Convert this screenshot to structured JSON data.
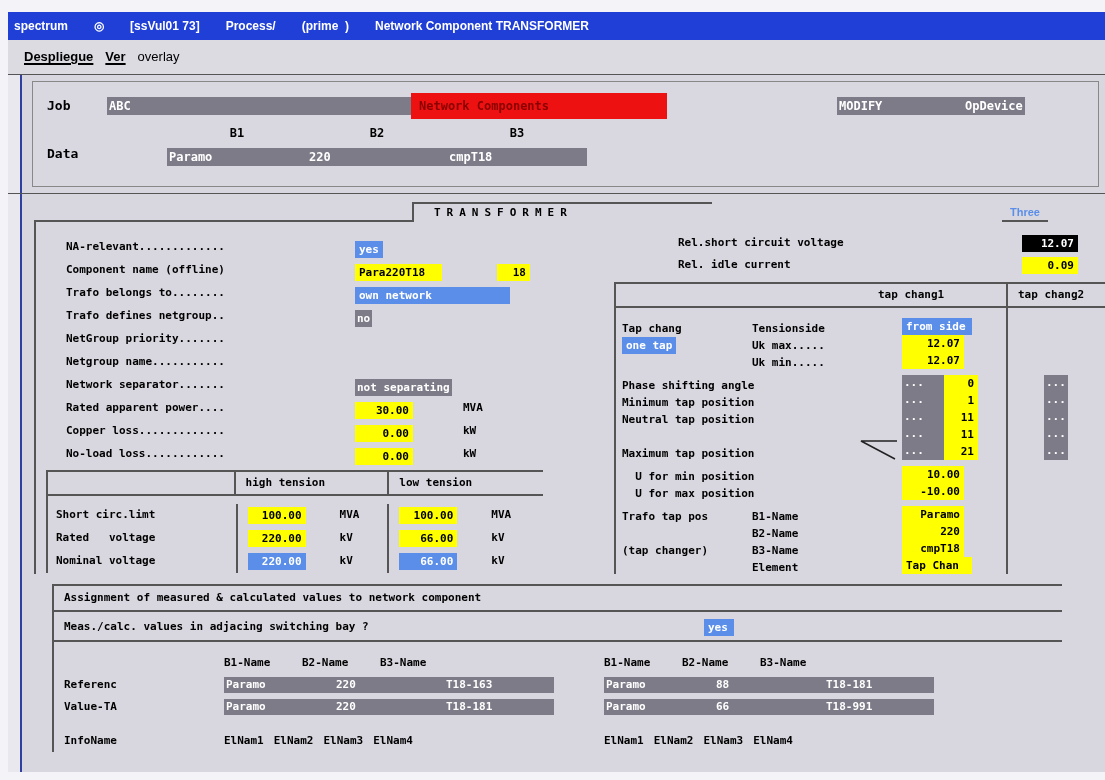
{
  "window": {
    "title_parts": [
      "spectrum",
      "◎",
      "[ssVul01 73]",
      "Process/",
      "(prime  )",
      "Network Component TRANSFORMER"
    ]
  },
  "menu": [
    {
      "label": "Despliegue",
      "mnemonic": true
    },
    {
      "label": "Ver",
      "mnemonic": true
    },
    {
      "label": "overlay",
      "mnemonic": false
    }
  ],
  "header": {
    "job_label": "Job",
    "job_value": "ABC",
    "banner": "Network Components",
    "mode": "MODIFY",
    "device": "OpDevice",
    "data_label": "Data",
    "columns": [
      {
        "heading": "B1",
        "value": "Paramo"
      },
      {
        "heading": "B2",
        "value": "220"
      },
      {
        "heading": "B3",
        "value": "cmpT18"
      }
    ]
  },
  "tab": {
    "title": "TRANSFORMER",
    "side_tab": "Three"
  },
  "fields": [
    {
      "label": "NA-relevant.............",
      "values": [
        {
          "text": "yes",
          "kind": "choice"
        }
      ]
    },
    {
      "label": "Component name (offline)",
      "values": [
        {
          "text": "Para220T18",
          "kind": "input"
        },
        {
          "text": "18",
          "kind": "input"
        }
      ]
    },
    {
      "label": "Trafo belongs to........",
      "values": [
        {
          "text": "own network",
          "kind": "choice"
        }
      ]
    },
    {
      "label": "Trafo defines netgroup..",
      "values": [
        {
          "text": "no",
          "kind": "readonly"
        }
      ]
    },
    {
      "label": "NetGroup priority......."
    },
    {
      "label": "Netgroup name..........."
    },
    {
      "label": "Network separator.......",
      "values": [
        {
          "text": "not separating",
          "kind": "readonly"
        }
      ]
    },
    {
      "label": "Rated apparent power....",
      "values": [
        {
          "text": "30.00",
          "kind": "input"
        }
      ],
      "unit": "MVA"
    },
    {
      "label": "Copper loss.............",
      "values": [
        {
          "text": "0.00",
          "kind": "input"
        }
      ],
      "unit": "kW"
    },
    {
      "label": "No-load loss............",
      "values": [
        {
          "text": "0.00",
          "kind": "input"
        }
      ],
      "unit": "kW"
    }
  ],
  "tension_table": {
    "columns": [
      "high tension",
      "low tension"
    ],
    "rows": [
      {
        "label": "Short circ.limt",
        "cells": [
          {
            "text": "100.00",
            "kind": "input",
            "unit": "MVA"
          },
          {
            "text": "100.00",
            "kind": "input",
            "unit": "MVA"
          }
        ]
      },
      {
        "label": "Rated   voltage",
        "cells": [
          {
            "text": "220.00",
            "kind": "input",
            "unit": "kV"
          },
          {
            "text": "66.00",
            "kind": "input",
            "unit": "kV"
          }
        ]
      },
      {
        "label": "Nominal voltage",
        "cells": [
          {
            "text": "220.00",
            "kind": "choice",
            "unit": "kV"
          },
          {
            "text": "66.00",
            "kind": "choice",
            "unit": "kV"
          }
        ]
      }
    ]
  },
  "rel": [
    {
      "label": "Rel.short circuit voltage",
      "value": {
        "text": "12.07",
        "kind": "dark"
      }
    },
    {
      "label": "Rel. idle current",
      "value": {
        "text": "0.09",
        "kind": "input"
      }
    }
  ],
  "tap_table": {
    "columns": [
      "tap chang1",
      "tap chang2"
    ],
    "rows": [
      {
        "label": "Tap chang",
        "sub": "Tensionside",
        "value": {
          "text": "from side",
          "kind": "choice"
        }
      },
      {
        "tag": {
          "text": "one tap",
          "kind": "choice"
        },
        "sub": "Uk max.....",
        "value": {
          "text": "12.07",
          "kind": "input"
        }
      },
      {
        "sub": "Uk min.....",
        "value": {
          "text": "12.07",
          "kind": "input"
        }
      },
      {
        "label": "Phase shifting angle",
        "value": {
          "text": "0",
          "kind": "input"
        },
        "dots_text": "...",
        "dots2_text": "..."
      },
      {
        "label": "Minimum tap position",
        "value": {
          "text": "1",
          "kind": "input"
        },
        "dots_text": "...",
        "dots2_text": "..."
      },
      {
        "label": "Neutral tap position",
        "value": {
          "text": "11",
          "kind": "input"
        },
        "dots_text": "...",
        "dots2_text": "..."
      },
      {
        "value": {
          "text": "11",
          "kind": "input"
        },
        "dots_text": "...",
        "dots2_text": "..."
      },
      {
        "label": "Maximum tap position",
        "value": {
          "text": "21",
          "kind": "input"
        },
        "dots_text": "...",
        "dots2_text": "..."
      },
      {
        "label": "  U for min position",
        "value": {
          "text": "10.00",
          "kind": "input"
        }
      },
      {
        "label": "  U for max position",
        "value": {
          "text": "-10.00",
          "kind": "input"
        }
      },
      {
        "label": "Trafo tap pos",
        "sub": "B1-Name",
        "value": {
          "text": "Paramo",
          "kind": "input"
        }
      },
      {
        "sub": "B2-Name",
        "value": {
          "text": "220",
          "kind": "input"
        }
      },
      {
        "label": "(tap changer)",
        "sub": "B3-Name",
        "value": {
          "text": "cmpT18",
          "kind": "input"
        }
      },
      {
        "sub": "Element",
        "value": {
          "text": "Tap Chan",
          "kind": "input"
        }
      }
    ]
  },
  "assignment": {
    "title": "Assignment of measured & calculated values to network component",
    "question": "Meas./calc. values in adjacing switching bay ?",
    "answer": "yes",
    "row_labels": [
      "Referenc",
      "Value-TA",
      "InfoName"
    ],
    "groups": [
      {
        "headings": [
          "B1-Name",
          "B2-Name",
          "B3-Name"
        ],
        "rows": [
          [
            "Paramo",
            "220",
            "T18-163"
          ],
          [
            "Paramo",
            "220",
            "T18-181"
          ]
        ],
        "info": [
          "ElNam1",
          "ElNam2",
          "ElNam3",
          "ElNam4"
        ]
      },
      {
        "headings": [
          "B1-Name",
          "B2-Name",
          "B3-Name"
        ],
        "rows": [
          [
            "Paramo",
            "88",
            "T18-181"
          ],
          [
            "Paramo",
            "66",
            "T18-991"
          ]
        ],
        "info": [
          "ElNam1",
          "ElNam2",
          "ElNam3",
          "ElNam4"
        ]
      }
    ]
  }
}
